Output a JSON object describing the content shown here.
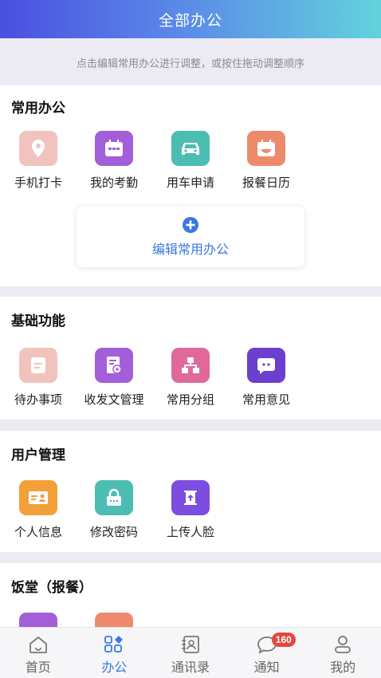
{
  "header": {
    "title": "全部办公"
  },
  "hint": "点击编辑常用办公进行调整，或按住拖动调整顺序",
  "common": {
    "title": "常用办公",
    "items": [
      {
        "label": "手机打卡",
        "icon": "location-pin-icon",
        "color": "#f2c3bd"
      },
      {
        "label": "我的考勤",
        "icon": "attendance-calendar-icon",
        "color": "#a25fd9"
      },
      {
        "label": "用车申请",
        "icon": "car-icon",
        "color": "#4cbdb3"
      },
      {
        "label": "报餐日历",
        "icon": "meal-calendar-icon",
        "color": "#ee8a6c"
      }
    ],
    "edit_label": "编辑常用办公"
  },
  "basic": {
    "title": "基础功能",
    "items": [
      {
        "label": "待办事项",
        "icon": "todo-icon",
        "color": "#f2c3bd"
      },
      {
        "label": "收发文管理",
        "icon": "document-icon",
        "color": "#a25fd9"
      },
      {
        "label": "常用分组",
        "icon": "group-tree-icon",
        "color": "#e0689a"
      },
      {
        "label": "常用意见",
        "icon": "chat-bubble-icon",
        "color": "#6b3fd0"
      }
    ]
  },
  "user": {
    "title": "用户管理",
    "items": [
      {
        "label": "个人信息",
        "icon": "id-card-icon",
        "color": "#f3a03a"
      },
      {
        "label": "修改密码",
        "icon": "lock-icon",
        "color": "#4cbdb3"
      },
      {
        "label": "上传人脸",
        "icon": "upload-face-icon",
        "color": "#7b4de0"
      }
    ]
  },
  "canteen": {
    "title": "饭堂（报餐）"
  },
  "tabbar": {
    "tabs": [
      {
        "label": "首页",
        "icon": "home-icon"
      },
      {
        "label": "办公",
        "icon": "office-grid-icon"
      },
      {
        "label": "通讯录",
        "icon": "contacts-icon"
      },
      {
        "label": "通知",
        "icon": "message-icon"
      },
      {
        "label": "我的",
        "icon": "profile-icon"
      }
    ],
    "active": "办公",
    "notice_badge": "160"
  }
}
